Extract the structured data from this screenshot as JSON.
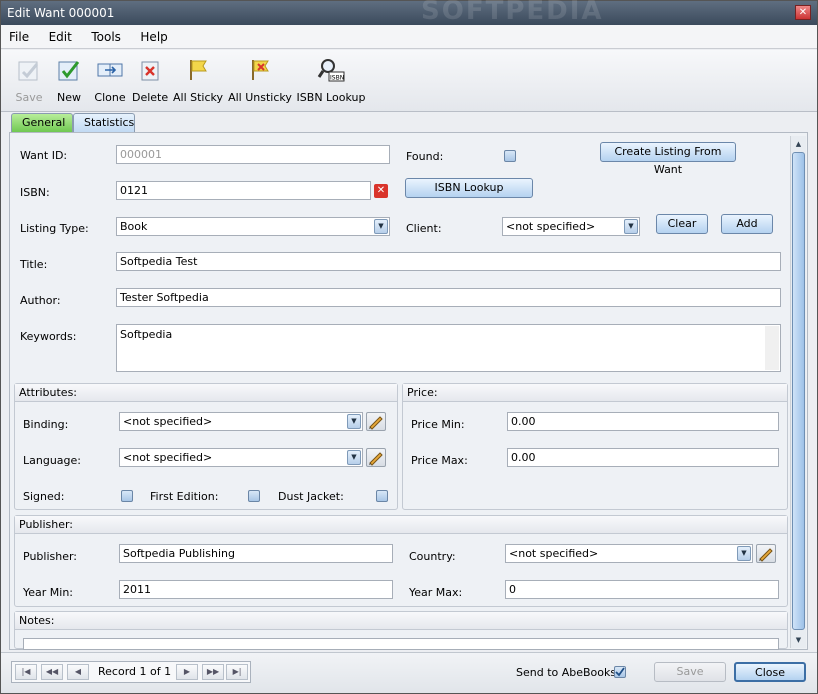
{
  "window": {
    "title": "Edit Want 000001",
    "watermark": "SOFTPEDIA"
  },
  "menu": [
    "File",
    "Edit",
    "Tools",
    "Help"
  ],
  "toolbar": {
    "save": "Save",
    "new": "New",
    "clone": "Clone",
    "delete": "Delete",
    "all_sticky": "All Sticky",
    "all_unsticky": "All Unsticky",
    "isbn_lookup": "ISBN Lookup"
  },
  "tabs": {
    "general": "General",
    "statistics": "Statistics"
  },
  "form": {
    "want_id_label": "Want ID:",
    "want_id_value": "000001",
    "found_label": "Found:",
    "create_listing_button": "Create Listing From Want",
    "isbn_label": "ISBN:",
    "isbn_value": "0121",
    "isbn_lookup_button": "ISBN Lookup",
    "listing_type_label": "Listing Type:",
    "listing_type_value": "Book",
    "client_label": "Client:",
    "client_value": "<not specified>",
    "clear_button": "Clear",
    "add_button": "Add",
    "title_label": "Title:",
    "title_value": "Softpedia Test",
    "author_label": "Author:",
    "author_value": "Tester Softpedia",
    "keywords_label": "Keywords:",
    "keywords_value": "Softpedia"
  },
  "attributes": {
    "header": "Attributes:",
    "binding_label": "Binding:",
    "binding_value": "<not specified>",
    "language_label": "Language:",
    "language_value": "<not specified>",
    "signed_label": "Signed:",
    "first_edition_label": "First Edition:",
    "dust_jacket_label": "Dust Jacket:"
  },
  "price": {
    "header": "Price:",
    "min_label": "Price Min:",
    "min_value": "0.00",
    "max_label": "Price Max:",
    "max_value": "0.00"
  },
  "publisher": {
    "header": "Publisher:",
    "publisher_label": "Publisher:",
    "publisher_value": "Softpedia Publishing",
    "country_label": "Country:",
    "country_value": "<not specified>",
    "year_min_label": "Year Min:",
    "year_min_value": "2011",
    "year_max_label": "Year Max:",
    "year_max_value": "0"
  },
  "notes": {
    "header": "Notes:"
  },
  "status": {
    "record_text": "Record 1 of 1",
    "send_to_label": "Send to AbeBooks:",
    "save_button": "Save",
    "close_button": "Close"
  },
  "colors": {
    "tab_active": "#6cc64e",
    "accent_button": "#b4d2f0",
    "delete_red": "#d9342b"
  }
}
